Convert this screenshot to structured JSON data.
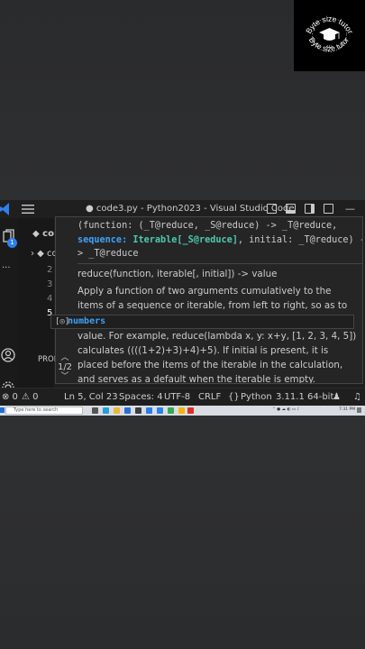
{
  "logo": {
    "text_top": "Byte size tutor",
    "text_bottom": "Byte size tutor"
  },
  "window": {
    "title": "● code3.py - Python2023 - Visual Studio Code"
  },
  "explorer": {
    "rows": [
      "◆ co",
      "› ◆ co",
      "2",
      "3",
      "4",
      "5",
      "PROB"
    ]
  },
  "hover": {
    "signature_line1": "(function: (_T@reduce, _S@reduce) -> _T@reduce,",
    "signature_line2_kw": "sequence:",
    "signature_line2_type": "Iterable[_S@reduce]",
    "signature_line2_rest": ", initial: _T@reduce) -",
    "signature_line3": "> _T@reduce",
    "doc_signature": "reduce(function, iterable[, initial]) -> value",
    "doc_paragraph1": "Apply a function of two arguments cumulatively to the items of a sequence or iterable, from left to right, so as to reduce the",
    "doc_paragraph2": "value. For example, reduce(lambda x, y: x+y, [1, 2, 3, 4, 5]) calculates ((((1+2)+3)+4)+5). If initial is present, it is placed before the items of the iterable in the calculation, and serves as a default when the iterable is empty.",
    "paging": "1/2"
  },
  "suggest": {
    "icon": "[◎]",
    "label": "numbers"
  },
  "status": {
    "errors": "⊗ 0",
    "warnings": "⚠ 0",
    "position": "Ln 5, Col 23",
    "spaces": "Spaces: 4",
    "encoding": "UTF-8",
    "eol": "CRLF",
    "language": "Python",
    "interpreter": "3.11.1 64-bit"
  },
  "taskbar": {
    "search_placeholder": "Type here to search",
    "clock": "7:31 PM"
  },
  "colors": {
    "accent": "#3fa2f7",
    "type": "#4ec9b0",
    "badge": "#2f80ed"
  }
}
